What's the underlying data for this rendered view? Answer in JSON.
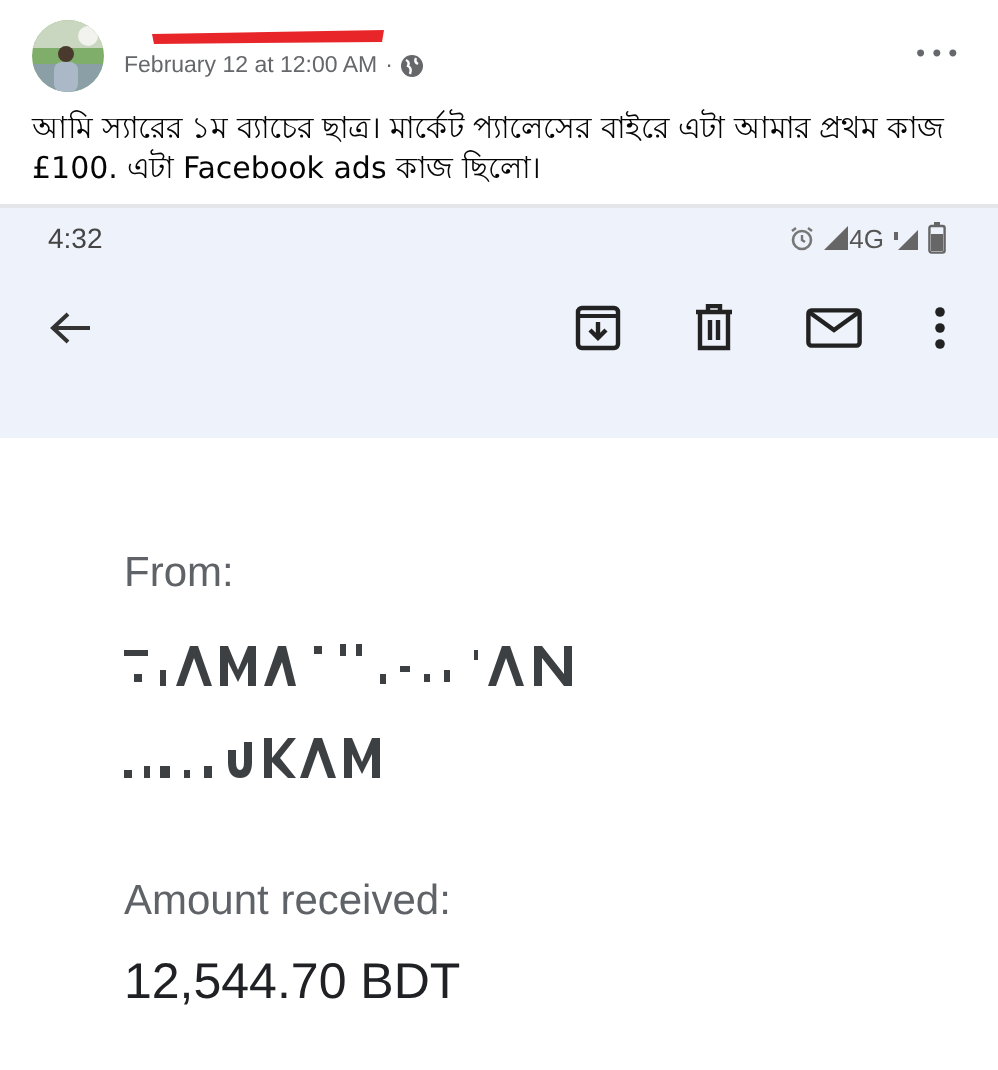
{
  "post": {
    "date": "February 12 at 12:00 AM",
    "separator": "·",
    "more": "•••",
    "text": "আমি স্যারের ১ম ব্যাচের ছাত্র। মার্কেট প্যালেসের বাইরে এটা আমার প্রথম কাজ £100. এটা Facebook ads কাজ ছিলো।"
  },
  "phone": {
    "time": "4:32",
    "network": "4G",
    "email": {
      "from_label": "From:",
      "amount_label": "Amount received:",
      "amount": "12,544.70 BDT"
    }
  }
}
